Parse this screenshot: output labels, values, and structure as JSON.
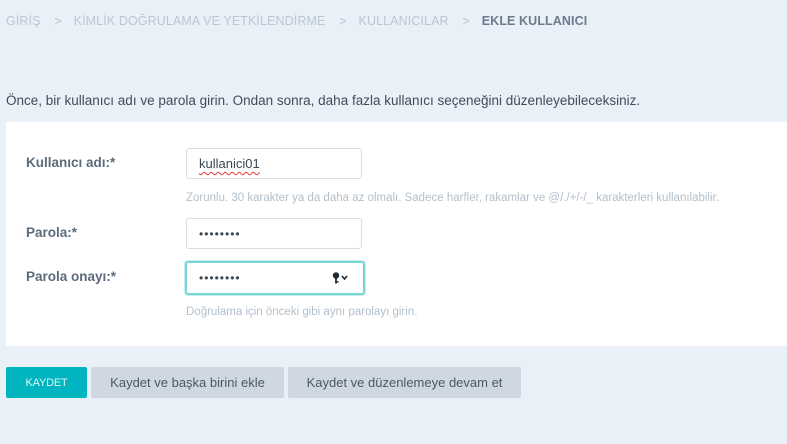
{
  "breadcrumb": {
    "items": [
      {
        "label": "GİRİŞ"
      },
      {
        "label": "KİMLİK DOĞRULAMA VE YETKİLENDİRME"
      },
      {
        "label": "KULLANICILAR"
      },
      {
        "label": "EKLE KULLANICI"
      }
    ],
    "separator": ">"
  },
  "intro_text": "Önce, bir kullanıcı adı ve parola girin. Ondan sonra, daha fazla kullanıcı seçeneğini düzenleyebileceksiniz.",
  "form": {
    "username": {
      "label": "Kullanıcı adı:*",
      "value": "kullanici01",
      "help": "Zorunlu. 30 karakter ya da daha az olmalı. Sadece harfler, rakamlar ve @/./+/-/_ karakterleri kullanılabilir."
    },
    "password": {
      "label": "Parola:*",
      "masked_value": "••••••••"
    },
    "password_confirm": {
      "label": "Parola onayı:*",
      "masked_value": "••••••••",
      "help": "Doğrulama için önceki gibi aynı parolayı girin.",
      "icon": "key-icon"
    }
  },
  "buttons": {
    "save": "KAYDET",
    "save_and_add": "Kaydet ve başka birini ekle",
    "save_and_continue": "Kaydet ve düzenlemeye devam et"
  },
  "colors": {
    "page_bg": "#eaf0f8",
    "accent": "#00b5c0",
    "focus_border": "#79d6d6",
    "secondary_button": "#cfd8e2"
  }
}
